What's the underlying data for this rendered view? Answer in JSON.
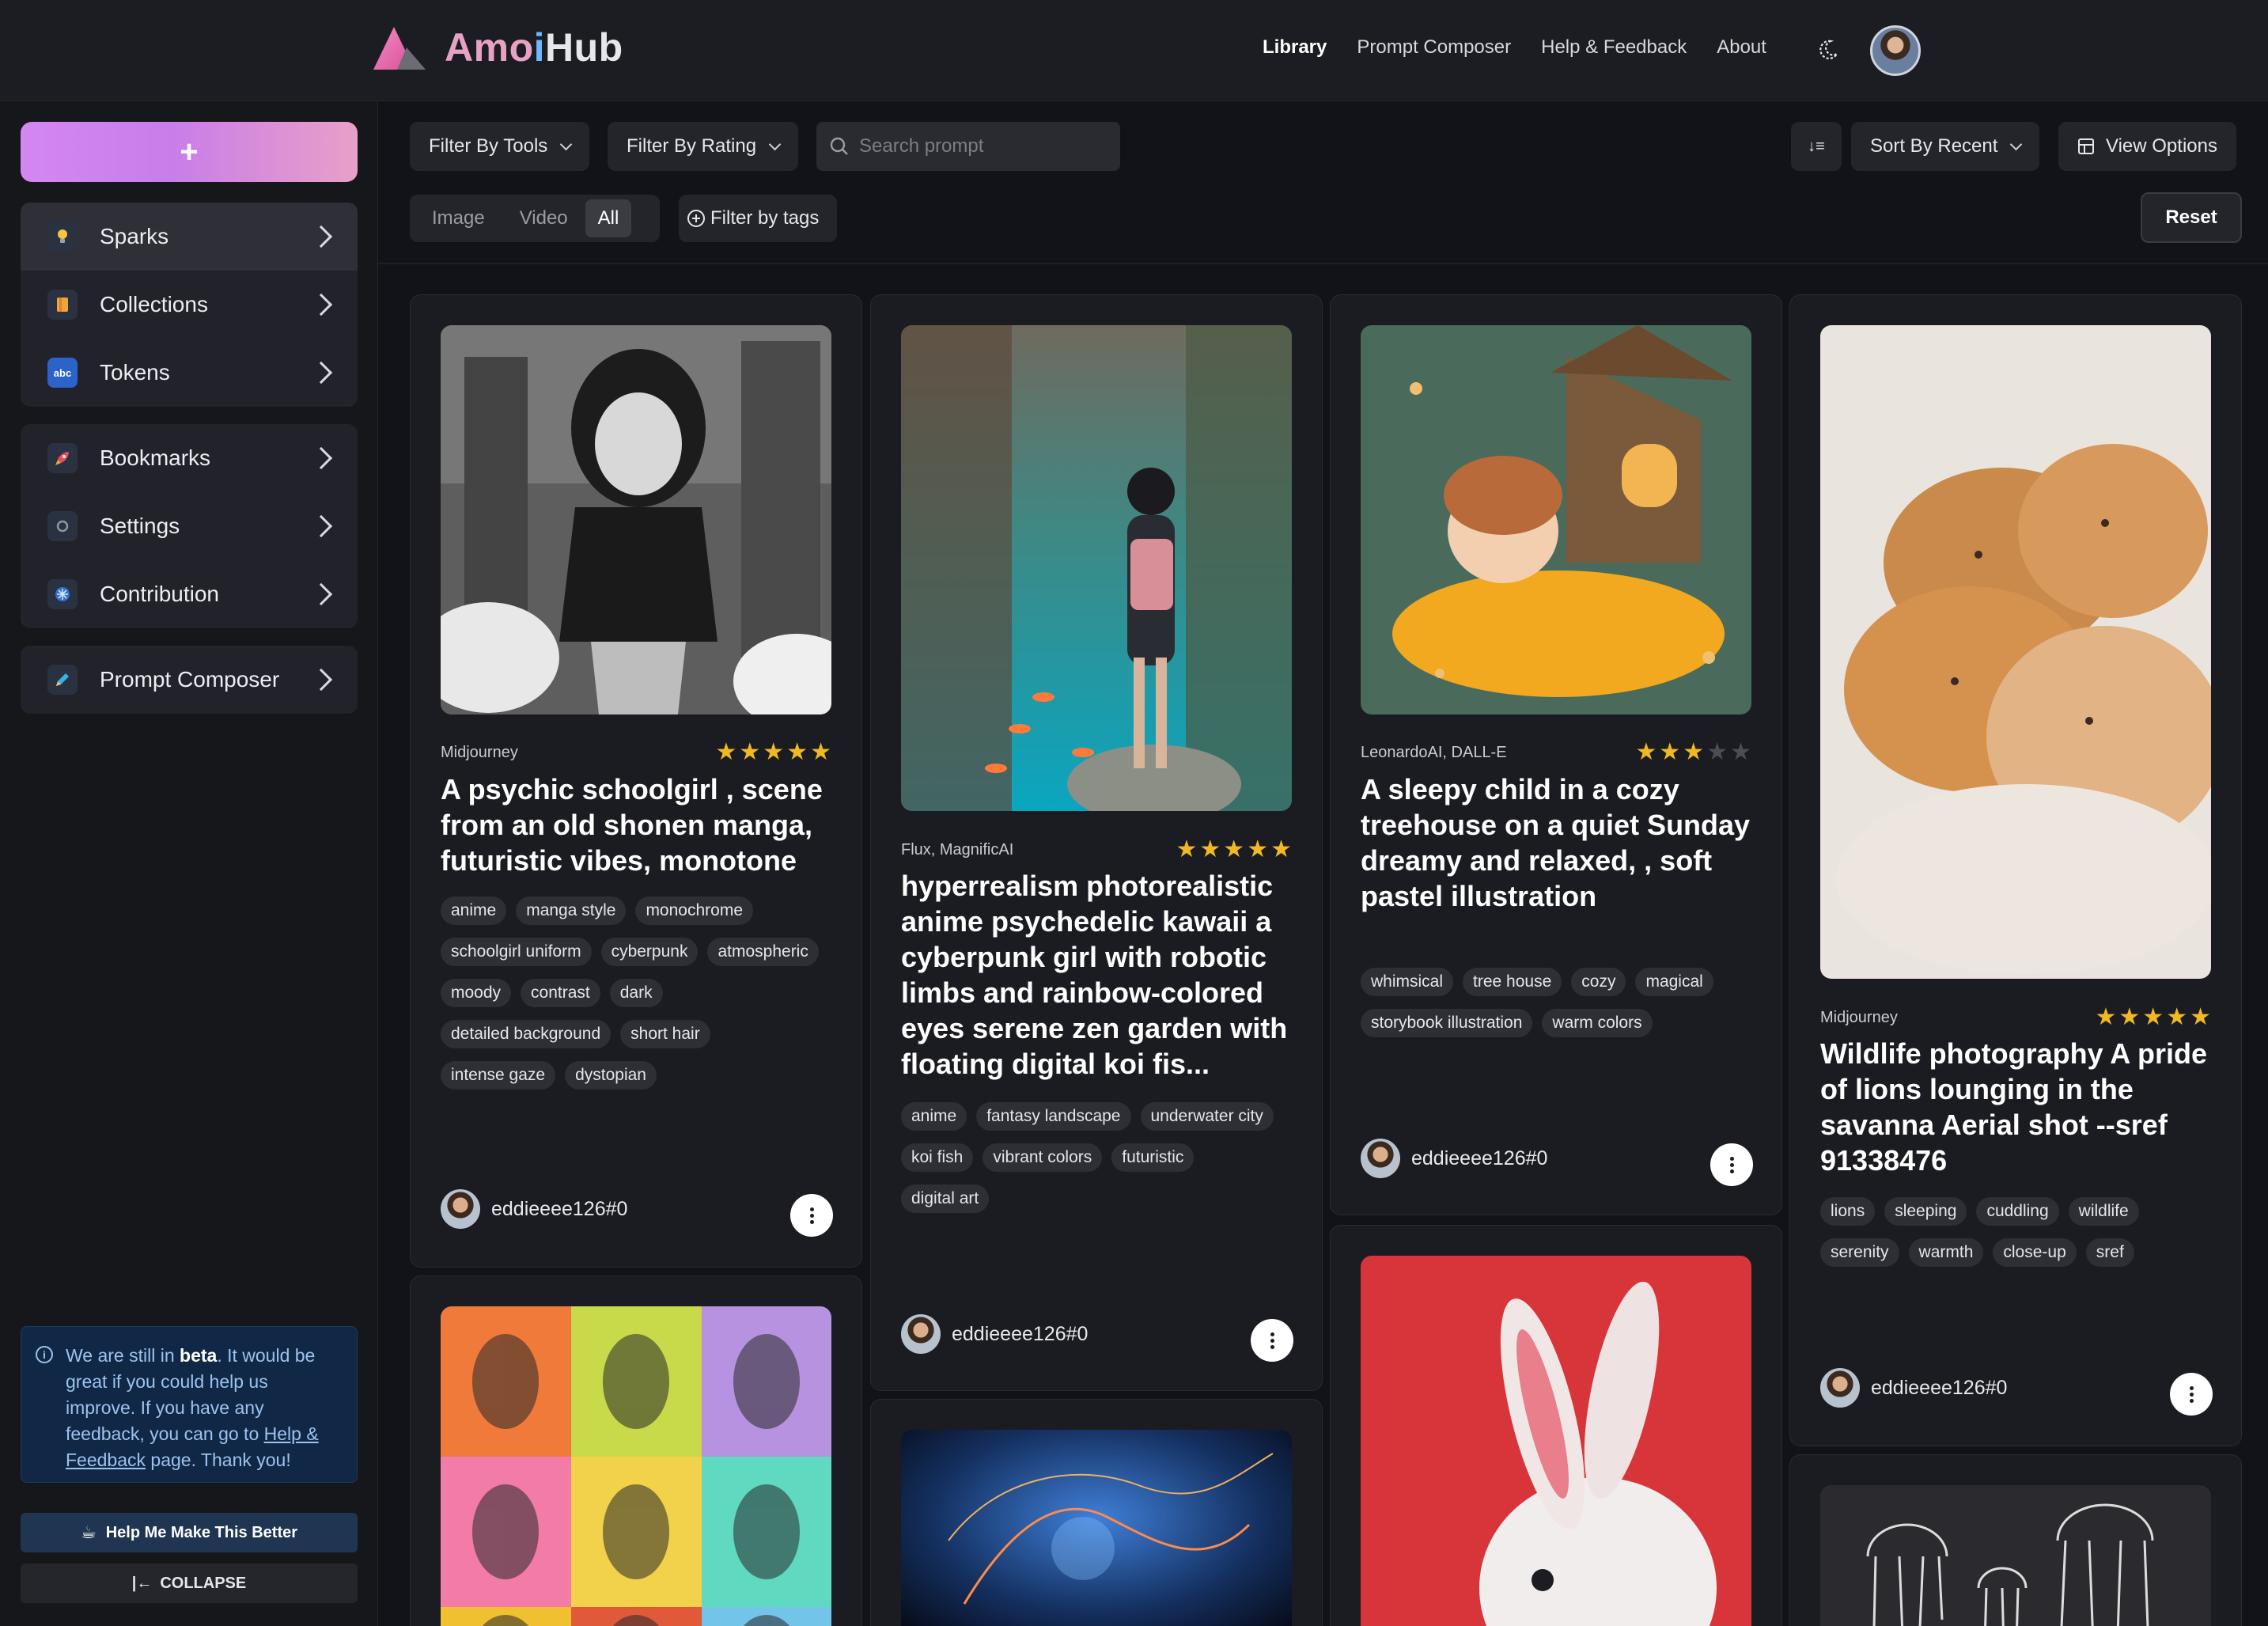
{
  "app": {
    "logo_part1": "Amo",
    "logo_part2": "i",
    "logo_part3": "Hub",
    "brand_colors": {
      "accent_pink": "#e7a1c4",
      "accent_blue": "#6fb6ff",
      "star": "#f0b923",
      "beta_bg": "#102846"
    }
  },
  "topnav": {
    "items": [
      "Library",
      "Prompt Composer",
      "Help & Feedback",
      "About"
    ],
    "active": "Library",
    "theme_icon": "moon-icon",
    "user_icon": "user-avatar"
  },
  "sidebar": {
    "new_button_label": "+",
    "groups": [
      {
        "items": [
          {
            "label": "Sparks",
            "icon": "lightbulb-icon"
          },
          {
            "label": "Collections",
            "icon": "collection-icon"
          },
          {
            "label": "Tokens",
            "icon": "abc-icon"
          }
        ]
      },
      {
        "items": [
          {
            "label": "Bookmarks",
            "icon": "rocket-icon"
          },
          {
            "label": "Settings",
            "icon": "circle-icon"
          },
          {
            "label": "Contribution",
            "icon": "snowflake-icon"
          }
        ]
      },
      {
        "items": [
          {
            "label": "Prompt Composer",
            "icon": "pen-icon"
          }
        ]
      }
    ],
    "beta": {
      "t1": "We are still in ",
      "t2": "beta",
      "t3": ". It would be great if you could help us improve. If you have any feedback, you can go to ",
      "t4": "Help & Feedback",
      "t5": " page. Thank you!"
    },
    "help_button_label": "Help Me Make This Better",
    "collapse_label": "COLLAPSE"
  },
  "filters": {
    "tools_label": "Filter By Tools",
    "rating_label": "Filter By Rating",
    "search_placeholder": "Search prompt",
    "sort_label": "Sort By Recent",
    "view_options_label": "View Options",
    "media_tabs": [
      "Image",
      "Video",
      "All"
    ],
    "active_media": "All",
    "tags_label": "Filter by tags",
    "reset_label": "Reset"
  },
  "cards": [
    {
      "tool": "Midjourney",
      "rating": 5,
      "title": "A psychic schoolgirl , scene from an old shonen manga, futuristic vibes, monotone",
      "tags": [
        "anime",
        "manga style",
        "monochrome",
        "schoolgirl uniform",
        "cyberpunk",
        "atmospheric",
        "moody",
        "contrast",
        "dark",
        "detailed background",
        "short hair",
        "intense gaze",
        "dystopian"
      ],
      "author": "eddieeee126#0"
    },
    {
      "tool": "Flux, MagnificAI",
      "rating": 5,
      "title": "hyperrealism photorealistic anime psychedelic kawaii a cyberpunk girl with robotic limbs and rainbow-colored eyes serene zen garden with floating digital koi fis...",
      "tags": [
        "anime",
        "fantasy landscape",
        "underwater city",
        "koi fish",
        "vibrant colors",
        "futuristic",
        "digital art"
      ],
      "author": "eddieeee126#0"
    },
    {
      "tool": "LeonardoAI, DALL-E",
      "rating": 3,
      "title": "A sleepy child in a cozy treehouse on a quiet Sunday dreamy and relaxed, , soft pastel illustration",
      "tags": [
        "whimsical",
        "tree house",
        "cozy",
        "magical",
        "storybook illustration",
        "warm colors"
      ],
      "author": "eddieeee126#0"
    },
    {
      "tool": "Midjourney",
      "rating": 5,
      "title": "Wildlife photography A pride of lions lounging in the savanna Aerial shot --sref 91338476",
      "tags": [
        "lions",
        "sleeping",
        "cuddling",
        "wildlife",
        "serenity",
        "warmth",
        "close-up",
        "sref"
      ],
      "author": "eddieeee126#0"
    }
  ]
}
